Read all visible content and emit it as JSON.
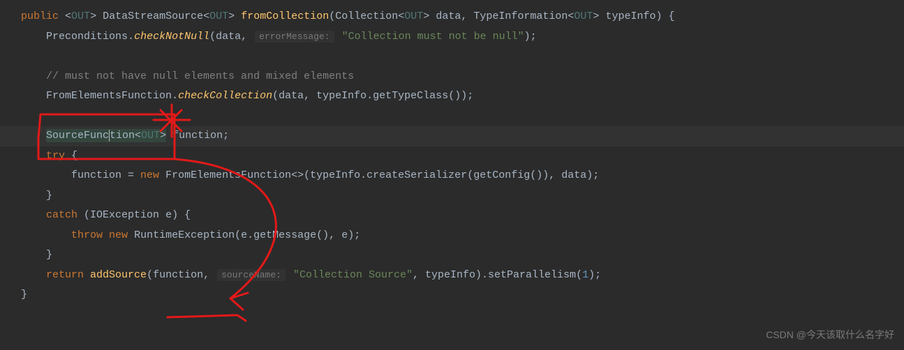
{
  "code": {
    "l1": {
      "kw_public": "public",
      "generic_open": "<",
      "generic_out": "OUT",
      "generic_close": ">",
      "ret_type": "DataStreamSource",
      "ret_gen_open": "<",
      "ret_gen_out": "OUT",
      "ret_gen_close": ">",
      "method": "fromCollection",
      "p1_type": "Collection",
      "p1_gen_open": "<",
      "p1_gen": "OUT",
      "p1_gen_close": ">",
      "p1_name": "data",
      "p2_type": "TypeInformation",
      "p2_gen_open": "<",
      "p2_gen": "OUT",
      "p2_gen_close": ">",
      "p2_name": "typeInfo",
      "brace": "{"
    },
    "l2": {
      "cls": "Preconditions",
      "method": "checkNotNull",
      "arg1": "data",
      "hint": "errorMessage:",
      "str": "\"Collection must not be null\""
    },
    "l4": {
      "comment": "// must not have null elements and mixed elements"
    },
    "l5": {
      "cls": "FromElementsFunction",
      "method": "checkCollection",
      "a1": "data",
      "a2": "typeInfo",
      "a2m": "getTypeClass"
    },
    "l7": {
      "type": "SourceFunction",
      "gen_open": "<",
      "gen": "OUT",
      "gen_close": ">",
      "var": "function"
    },
    "l8": {
      "kw": "try",
      "brace": "{"
    },
    "l9": {
      "lhs": "function",
      "kw_new": "new",
      "cls": "FromElementsFunction",
      "a1": "typeInfo",
      "a1m": "createSerializer",
      "a1i": "getConfig",
      "a2": "data"
    },
    "l10": {
      "brace": "}"
    },
    "l11": {
      "kw": "catch",
      "type": "IOException",
      "name": "e",
      "brace": "{"
    },
    "l12": {
      "kw_throw": "throw",
      "kw_new": "new",
      "cls": "RuntimeException",
      "a1": "e",
      "a1m": "getMessage",
      "a2": "e"
    },
    "l13": {
      "brace": "}"
    },
    "l14": {
      "kw": "return",
      "method": "addSource",
      "a1": "function",
      "hint": "sourceName:",
      "str": "\"Collection Source\"",
      "a3": "typeInfo",
      "chain": "setParallelism",
      "num": "1"
    },
    "l15": {
      "brace": "}"
    }
  },
  "watermark": "CSDN @今天该取什么名字好",
  "colors": {
    "annotation": "#e21919"
  }
}
